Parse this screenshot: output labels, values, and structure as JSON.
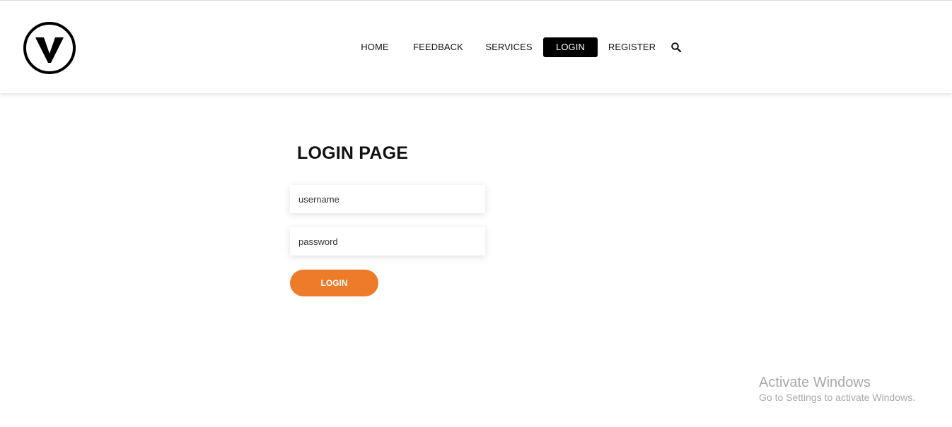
{
  "header": {
    "logo": {
      "icon": "v-logo-icon",
      "letter": "V"
    },
    "nav": [
      {
        "label": "HOME"
      },
      {
        "label": "FEEDBACK"
      },
      {
        "label": "SERVICES"
      },
      {
        "label": "LOGIN"
      },
      {
        "label": "REGISTER"
      }
    ],
    "search": {
      "icon": "search-icon"
    }
  },
  "main": {
    "title": "LOGIN PAGE",
    "username_placeholder": "username",
    "password_placeholder": "password",
    "login_label": "LOGIN"
  },
  "watermark": {
    "title": "Activate Windows",
    "subtitle": "Go to Settings to activate Windows."
  },
  "colors": {
    "accent": "#ee7b2a",
    "nav_active_bg": "#000000",
    "nav_active_text": "#ffffff"
  }
}
